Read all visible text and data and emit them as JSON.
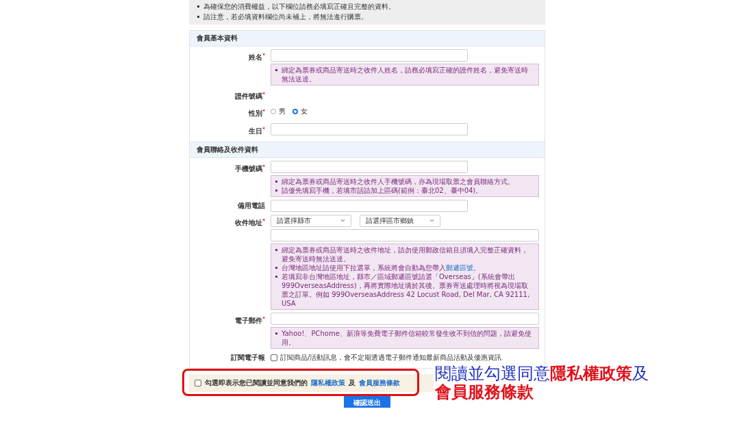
{
  "notice": [
    "為確保您的消費權益，以下欄位請務必填寫正確且完整的資料。",
    "請注意，若必填資料欄位尚未補上，將無法進行購票。"
  ],
  "sections": [
    {
      "title": "會員基本資料",
      "fields": [
        {
          "kind": "text",
          "label": "姓名$^{*}$",
          "notes": [
            {
              "text": "綁定為票券或商品寄送時之收件人姓名，請務必填寫正確的證件姓名，避免寄送時無法送達。"
            }
          ]
        },
        {
          "kind": "none",
          "label": "證件號碼$^{*}$"
        },
        {
          "kind": "radio",
          "label": "性別$^{*}$",
          "options": [
            {
              "label": "男",
              "selected": false
            },
            {
              "label": "女",
              "selected": true
            }
          ]
        },
        {
          "kind": "text",
          "label": "生日$^{*}$"
        }
      ]
    },
    {
      "title": "會員聯絡及收件資料",
      "fields": [
        {
          "kind": "text",
          "label": "手機號碼$^{*}$",
          "notes": [
            {
              "text": "綁定為票券或商品寄送時之收件人手機號碼，亦為現場取票之會員聯絡方式。"
            },
            {
              "text": "請優先填寫手機，若填市話請加上區碼(範例：臺北02、臺中04)。"
            }
          ]
        },
        {
          "kind": "text",
          "label": "備用電話"
        },
        {
          "kind": "address",
          "label": "收件地址$^{*}$",
          "selects": [
            "請選擇縣市",
            "請選擇區市鄉鎮"
          ],
          "notes": [
            {
              "text": "綁定為票券或商品寄送時之收件地址，請勿使用郵政信箱且須填入完整正確資料，避免寄送時無法送達。"
            },
            {
              "text": "台灣地區地址請使用下拉選單，系統將會自動為您帶入",
              "link": "郵遞區號",
              "after": "。"
            },
            {
              "text": "若填寫非台灣地區地址，縣市／區域郵遞區號請選「Overseas」(系統會帶出999OverseasAddress)，再將實際地址填於其後。票券寄送處理時將視為現場取票之訂單。例如 999OverseasAddress 42 Locust Road, Del Mar, CA 92111, USA"
            }
          ]
        },
        {
          "kind": "wide",
          "label": "電子郵件$^{*}$",
          "notes": [
            {
              "text": "Yahoo!、PChome、新浪等免費電子郵件信箱較常發生收不到信的問題，請避免使用。"
            }
          ]
        },
        {
          "kind": "checkbox",
          "label": "訂閱電子報",
          "text": "訂閱商品/活動訊息，會不定期透過電子郵件通知最新商品活動及優惠資訊",
          "checked": false
        }
      ]
    }
  ],
  "agreement": {
    "checked": false,
    "text": "勾選即表示您已閱讀並同意我們的",
    "link1": "隱私權政策",
    "joiner": "及",
    "link2": "會員服務條款"
  },
  "submit": "確認送出",
  "annotation": {
    "lines": [
      [
        {
          "text": "閱讀並勾選同意",
          "color": "#1f2fbf"
        },
        {
          "text": "隱私權政策",
          "color": "#e0101a"
        },
        {
          "text": "及",
          "color": "#1f2fbf"
        }
      ],
      [
        {
          "text": "會員服務條款",
          "color": "#e0101a"
        }
      ]
    ]
  }
}
